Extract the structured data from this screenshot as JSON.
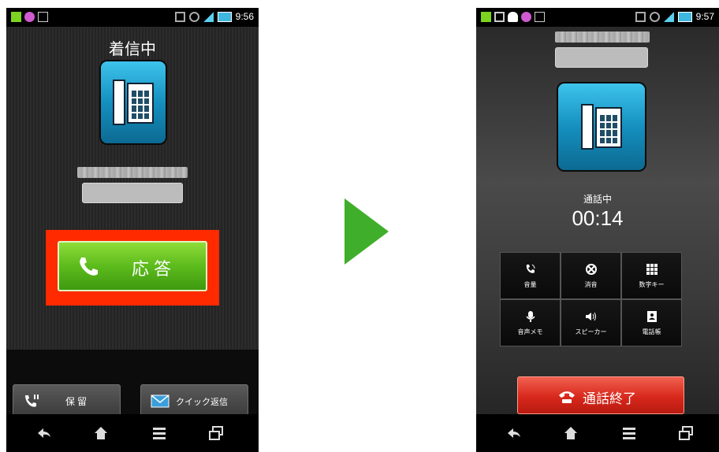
{
  "left": {
    "status_time": "9:56",
    "title": "着信中",
    "answer_label": "応答",
    "hold_label": "保留",
    "quick_reply_label": "クイック返信"
  },
  "right": {
    "status_time": "9:57",
    "call_status": "通話中",
    "timer": "00:14",
    "controls": [
      {
        "label": "音量",
        "icon": "volume-icon"
      },
      {
        "label": "消音",
        "icon": "mute-icon"
      },
      {
        "label": "数字キー",
        "icon": "keypad-icon"
      },
      {
        "label": "音声メモ",
        "icon": "voice-memo-icon"
      },
      {
        "label": "スピーカー",
        "icon": "speaker-icon"
      },
      {
        "label": "電話帳",
        "icon": "phonebook-icon"
      }
    ],
    "end_call_label": "通話終了"
  },
  "colors": {
    "answer_green": "#5cbb1c",
    "highlight_red": "#ff2a00",
    "end_red": "#d8281c",
    "arrow_green": "#3fae2a",
    "icon_blue": "#1590bf"
  }
}
